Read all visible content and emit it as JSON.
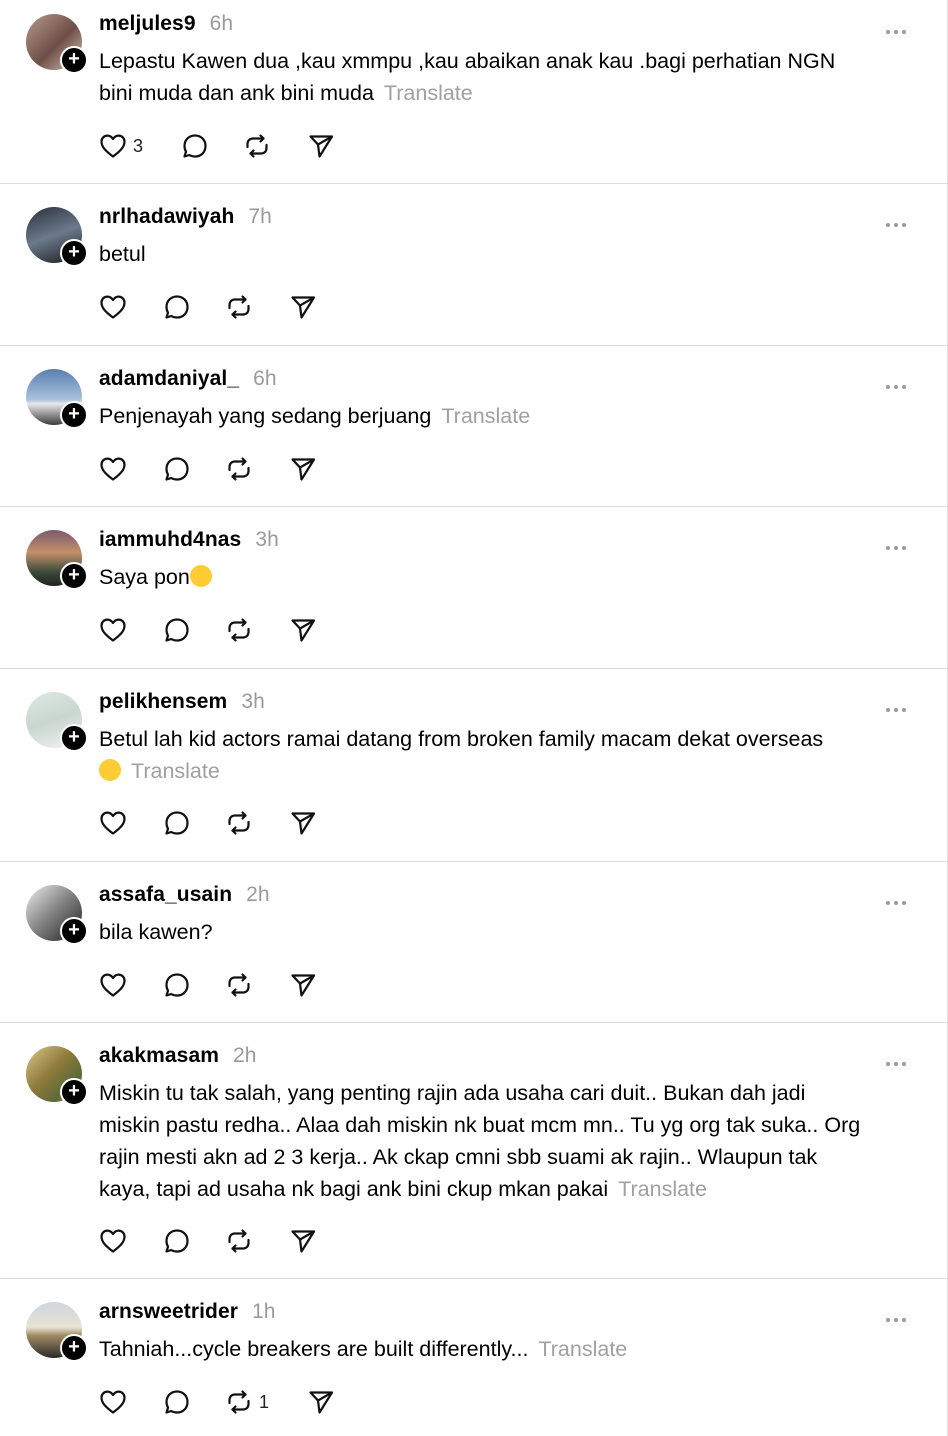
{
  "posts": [
    {
      "username": "meljules9",
      "time": "6h",
      "text": "Lepastu Kawen dua ,kau xmmpu ,kau abaikan anak kau .bagi perhatian NGN",
      "text2": "bini muda dan ank bini muda",
      "translate": "Translate",
      "likes": "3",
      "reposts": ""
    },
    {
      "username": "nrlhadawiyah",
      "time": "7h",
      "text": "betul",
      "translate": "",
      "likes": "",
      "reposts": ""
    },
    {
      "username": "adamdaniyal_",
      "time": "6h",
      "text": "Penjenayah yang sedang berjuang",
      "translate": "Translate",
      "likes": "",
      "reposts": ""
    },
    {
      "username": "iammuhd4nas",
      "time": "3h",
      "text": "Saya pon",
      "translate": "",
      "likes": "",
      "reposts": ""
    },
    {
      "username": "pelikhensem",
      "time": "3h",
      "text": "Betul lah kid actors ramai datang from broken family macam dekat overseas",
      "translate": "Translate",
      "likes": "",
      "reposts": ""
    },
    {
      "username": "assafa_usain",
      "time": "2h",
      "text": "bila kawen?",
      "translate": "",
      "likes": "",
      "reposts": ""
    },
    {
      "username": "akakmasam",
      "time": "2h",
      "lines": [
        "Miskin tu tak salah, yang penting rajin ada usaha cari duit.. Bukan dah jadi",
        "miskin pastu redha.. Alaa dah miskin nk buat mcm mn.. Tu yg org tak suka.. Org",
        "rajin mesti akn ad 2 3 kerja.. Ak ckap cmni sbb suami ak rajin.. Wlaupun tak",
        "kaya, tapi ad usaha nk bagi ank bini ckup mkan pakai"
      ],
      "translate": "Translate",
      "likes": "",
      "reposts": ""
    },
    {
      "username": "arnsweetrider",
      "time": "1h",
      "text": "Tahniah...cycle breakers are built differently...",
      "translate": "Translate",
      "likes": "",
      "reposts": "1"
    }
  ],
  "icons": {
    "like": "heart-icon",
    "reply": "comment-icon",
    "repost": "repost-icon",
    "share": "send-icon",
    "more": "more-icon",
    "follow": "plus-icon"
  },
  "colors": {
    "muted": "#9a9a9a",
    "divider": "#dcdcdc",
    "text": "#000000"
  }
}
